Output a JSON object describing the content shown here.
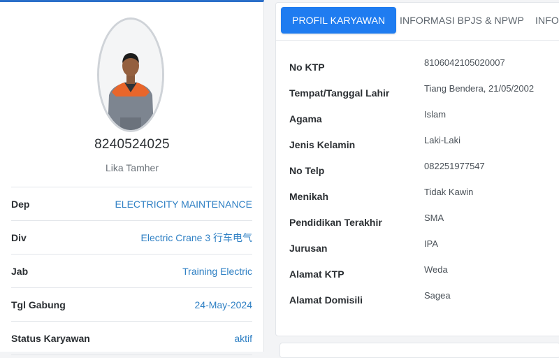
{
  "profile": {
    "employee_id": "8240524025",
    "name": "Lika Tamher",
    "details": [
      {
        "label": "Dep",
        "value": "ELECTRICITY MAINTENANCE"
      },
      {
        "label": "Div",
        "value": "Electric Crane 3 行车电气"
      },
      {
        "label": "Jab",
        "value": "Training Electric"
      },
      {
        "label": "Tgl Gabung",
        "value": "24-May-2024"
      },
      {
        "label": "Status Karyawan",
        "value": "aktif"
      }
    ]
  },
  "tabs": [
    {
      "label": "PROFIL KARYAWAN",
      "active": true
    },
    {
      "label": "INFORMASI BPJS & NPWP",
      "active": false
    },
    {
      "label": "INFOR",
      "active": false
    }
  ],
  "fields": [
    {
      "label": "No KTP",
      "value": "8106042105020007"
    },
    {
      "label": "Tempat/Tanggal Lahir",
      "value": "Tiang Bendera, 21/05/2002"
    },
    {
      "label": "Agama",
      "value": "Islam"
    },
    {
      "label": "Jenis Kelamin",
      "value": "Laki-Laki"
    },
    {
      "label": "No Telp",
      "value": "082251977547"
    },
    {
      "label": "Menikah",
      "value": "Tidak Kawin"
    },
    {
      "label": "Pendidikan Terakhir",
      "value": "SMA"
    },
    {
      "label": "Jurusan",
      "value": "IPA"
    },
    {
      "label": "Alamat KTP",
      "value": "Weda"
    },
    {
      "label": "Alamat Domisili",
      "value": "Sagea"
    }
  ],
  "colors": {
    "accent": "#1f7cf0",
    "link": "#2f80c4",
    "top_border": "#2b6fc9"
  },
  "icons": {
    "photo": "employee-photo"
  }
}
